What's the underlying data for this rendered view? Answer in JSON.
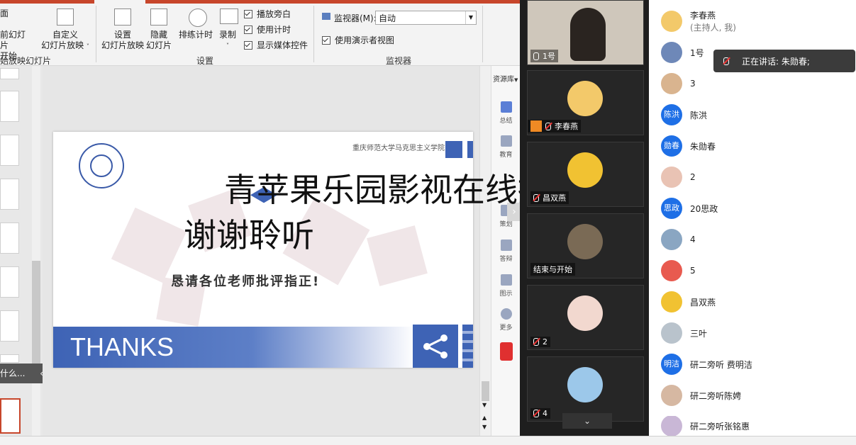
{
  "ribbon": {
    "from_current_line1": "前幻灯片",
    "from_current_line2": "开始",
    "partial_top": "面",
    "custom_show_line1": "自定义",
    "custom_show_line2": "幻灯片放映",
    "start_group_label": "始放映幻灯片",
    "setup_line1": "设置",
    "setup_line2": "幻灯片放映",
    "hide_line1": "隐藏",
    "hide_line2": "幻灯片",
    "rehearse": "排练计时",
    "record": "录制",
    "play_narration": "播放旁白",
    "use_timings": "使用计时",
    "show_media": "显示媒体控件",
    "setup_group_label": "设置",
    "monitor_label": "监视器(M):",
    "monitor_value": "自动",
    "presenter_view": "使用演示者视图",
    "monitor_group_label": "监视器"
  },
  "thumbs_overlay": "什么...",
  "resources": {
    "header": "资源库",
    "items": [
      "总结",
      "教育",
      "策划",
      "答辩",
      "图示",
      "更多"
    ]
  },
  "slide": {
    "school_name": "重庆师范大学马克思主义学院",
    "title": "谢谢聆听",
    "subtitle": "恳请各位老师批评指正!",
    "thanks": "THANKS"
  },
  "overlay_text": "青苹果乐园影视在线播放",
  "video_tiles": [
    {
      "label": "1号"
    },
    {
      "label": "李春燕"
    },
    {
      "label": "昌双燕"
    },
    {
      "label": "结束与开始"
    },
    {
      "label": "2"
    },
    {
      "label": "4"
    }
  ],
  "speaking_banner": "正在讲话: 朱勋春;",
  "participants": [
    {
      "name": "李春燕",
      "role": "(主持人, 我)"
    },
    {
      "name": "1号"
    },
    {
      "name": "3"
    },
    {
      "name": "陈洪",
      "initials": "陈洪",
      "color": "#1e6fe6"
    },
    {
      "name": "朱勋春",
      "initials": "勋春",
      "color": "#1e6fe6"
    },
    {
      "name": "2"
    },
    {
      "name": "20思政",
      "initials": "思政",
      "color": "#1e6fe6"
    },
    {
      "name": "4"
    },
    {
      "name": "5"
    },
    {
      "name": "昌双燕"
    },
    {
      "name": "三叶"
    },
    {
      "name": "研二旁听 费明洁",
      "initials": "明洁",
      "color": "#1e6fe6"
    },
    {
      "name": "研二旁听陈娉"
    },
    {
      "name": "研二旁听张铭惠"
    }
  ],
  "colors": {
    "accent": "#c7462b",
    "slide_blue": "#3e63b5",
    "avatar_blue": "#1e6fe6"
  }
}
